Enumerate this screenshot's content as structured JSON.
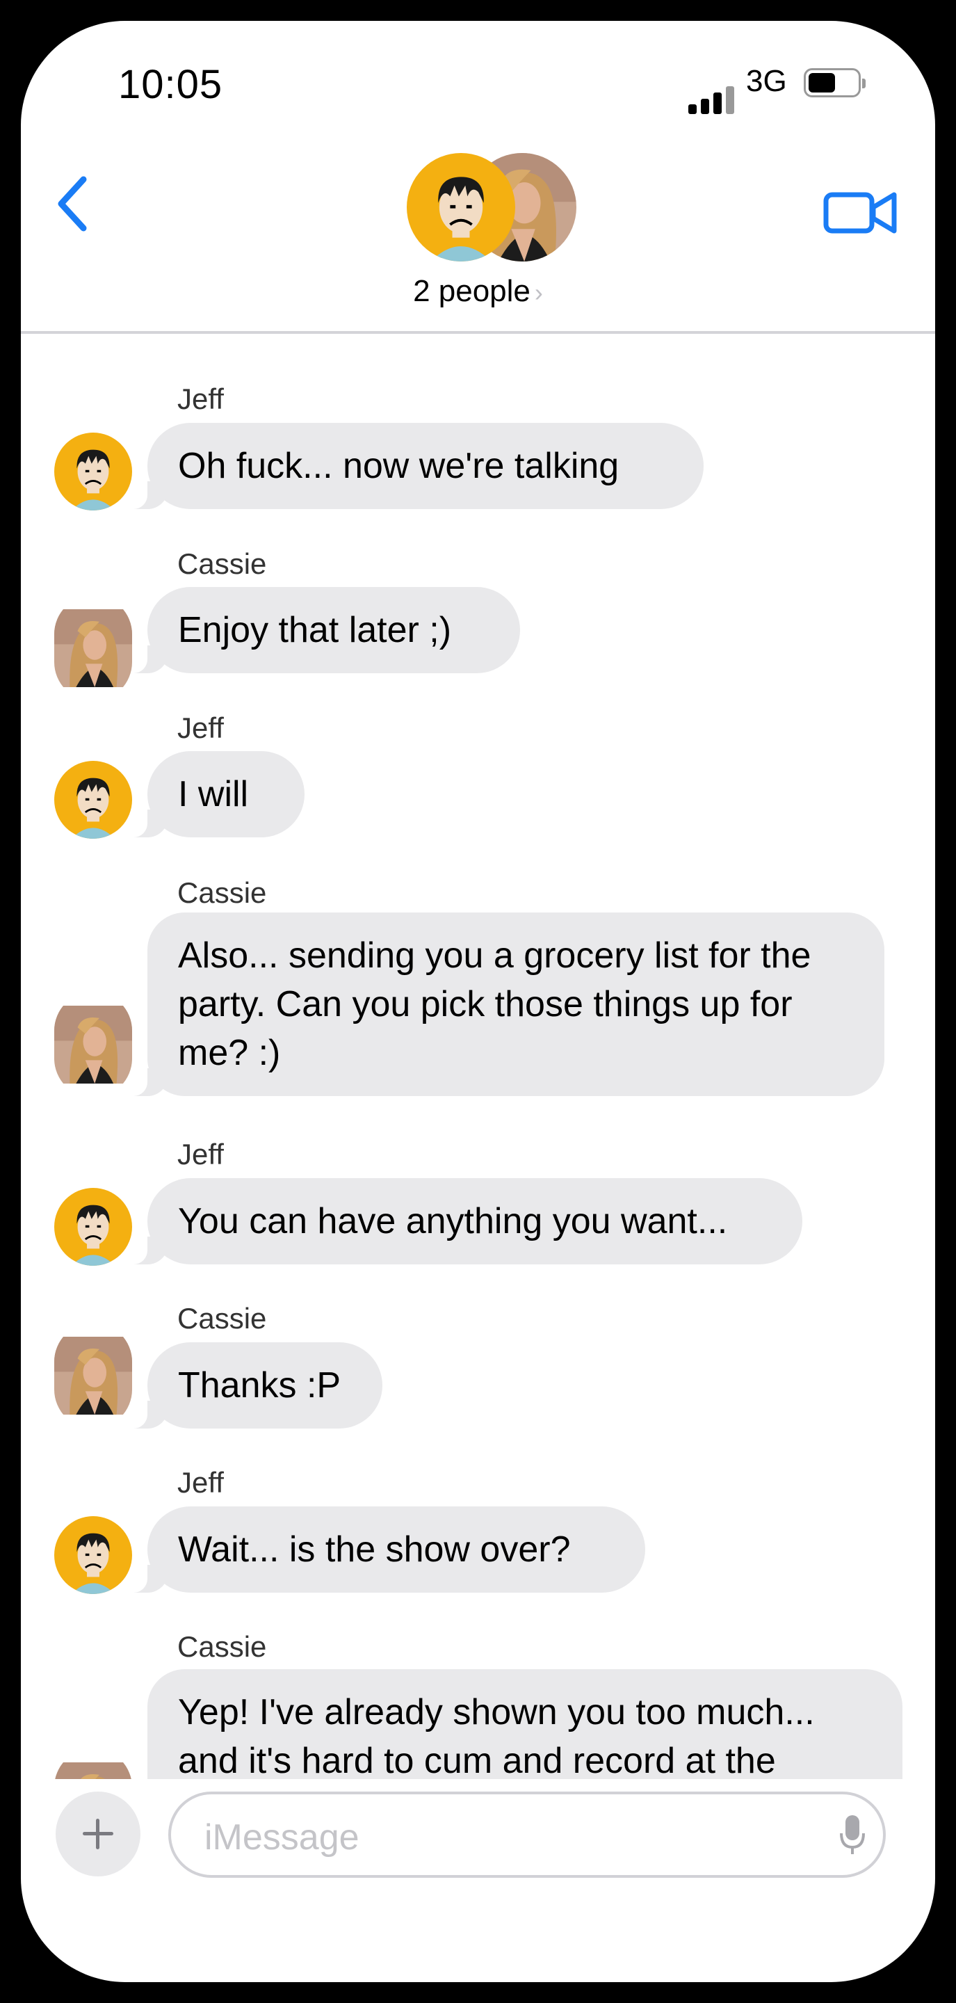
{
  "status_bar": {
    "time": "10:05",
    "network": "3G"
  },
  "header": {
    "people_label": "2 people",
    "chevron": "›"
  },
  "messages": [
    {
      "sender": "Jeff",
      "text": "Oh fuck... now we're talking"
    },
    {
      "sender": "Cassie",
      "text": "Enjoy that later ;)"
    },
    {
      "sender": "Jeff",
      "text": "I will"
    },
    {
      "sender": "Cassie",
      "text": "Also... sending you a grocery list for the\nparty.  Can you pick those things up for\nme? :)"
    },
    {
      "sender": "Jeff",
      "text": "You can have anything you want..."
    },
    {
      "sender": "Cassie",
      "text": "Thanks :P"
    },
    {
      "sender": "Jeff",
      "text": "Wait... is the show over?"
    },
    {
      "sender": "Cassie",
      "text": "Yep!  I've already shown you too much...\nand it's hard to cum and record at the\nsame time, you know? "
    }
  ],
  "composer": {
    "placeholder": "iMessage"
  },
  "colors": {
    "accent": "#1a7cf5",
    "bubble": "#e9e9eb",
    "jeff_avatar_bg": "#f4b011"
  },
  "icons": [
    "back-chevron-icon",
    "video-call-icon",
    "plus-icon",
    "microphone-icon",
    "signal-icon",
    "battery-icon"
  ]
}
